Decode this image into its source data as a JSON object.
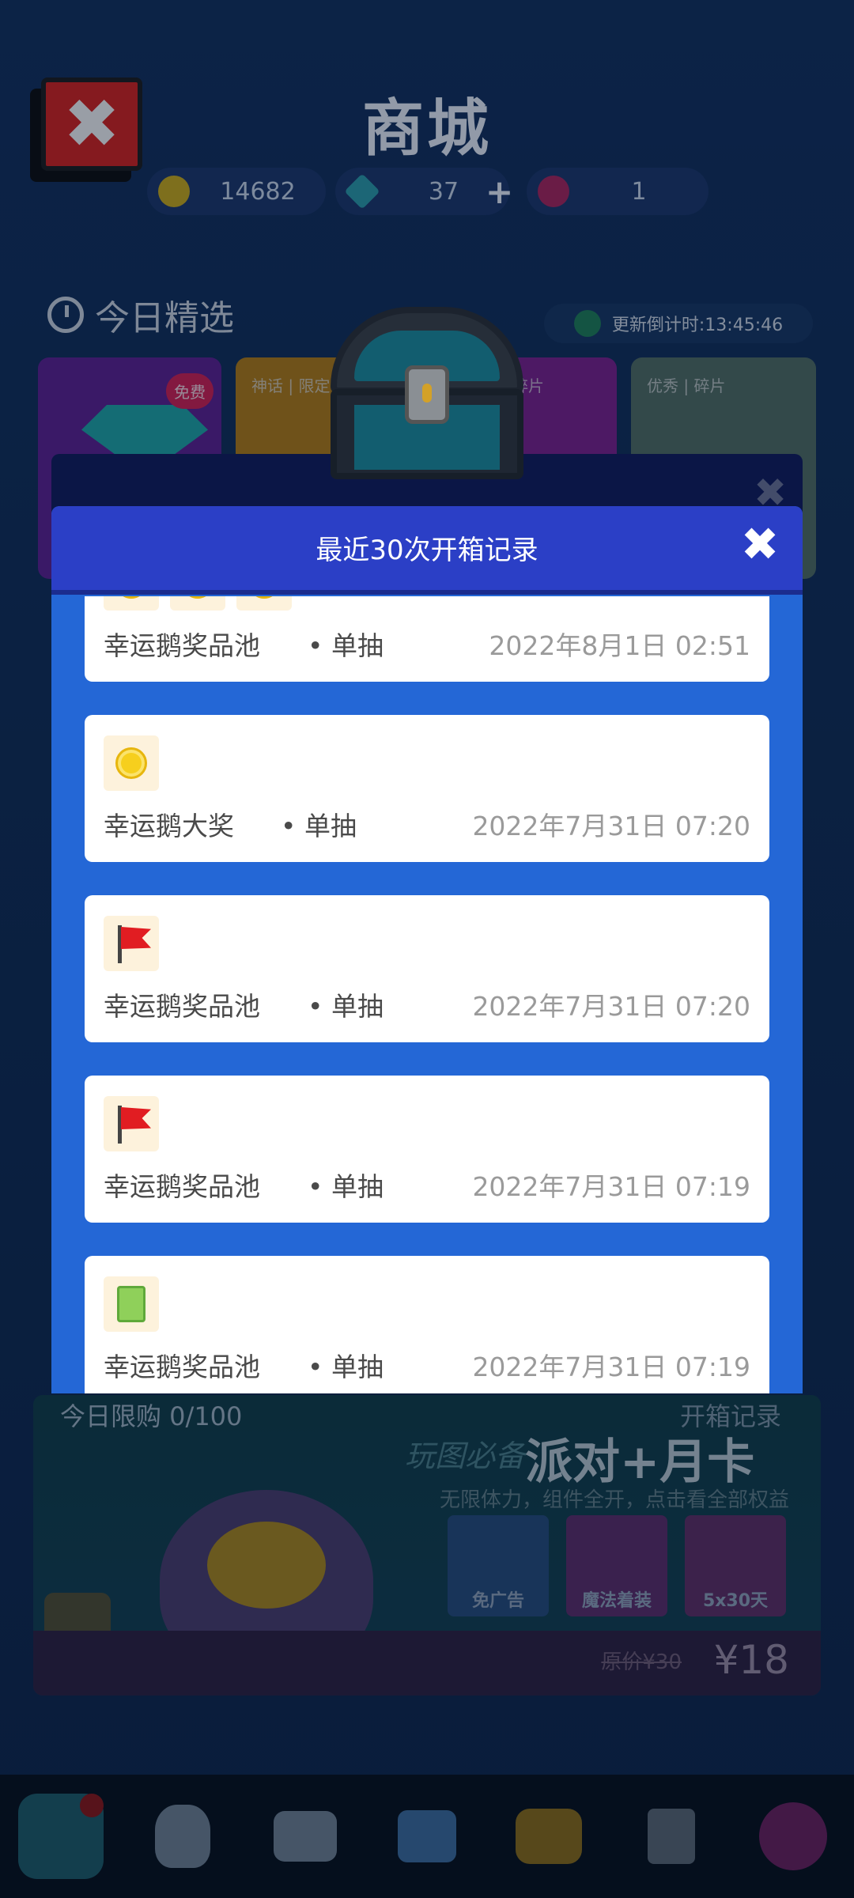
{
  "store": {
    "close_symbol": "✖",
    "title": "商城",
    "coins": "14682",
    "diamonds": "37",
    "plus": "+",
    "tickets": "1",
    "section_title": "今日精选",
    "timer": "更新倒计时:13:45:46",
    "cards": [
      {
        "badge": "免费",
        "label": ""
      },
      {
        "badge": "",
        "label": "神话 | 限定"
      },
      {
        "badge": "",
        "label": "碎片"
      },
      {
        "badge": "",
        "label": "优秀 | 碎片"
      }
    ]
  },
  "promo": {
    "limit": "今日限购 0/100",
    "records_link": "开箱记录",
    "script": "玩图必备",
    "title": "派对+月卡",
    "subtitle": "无限体力，组件全开，点击看全部权益",
    "tiles": [
      "免广告",
      "魔法着装",
      "5x30天"
    ],
    "old_price": "原价¥30",
    "price": "¥18"
  },
  "modal": {
    "title": "最近30次开箱记录",
    "close_symbol": "✖",
    "records": [
      {
        "name": "幸运鹅奖品池",
        "type": "• 单抽",
        "time": "2022年8月1日 02:51",
        "icons": [
          "coin",
          "coin",
          "coin"
        ]
      },
      {
        "name": "幸运鹅大奖",
        "type": "• 单抽",
        "time": "2022年7月31日 07:20",
        "icons": [
          "coin"
        ]
      },
      {
        "name": "幸运鹅奖品池",
        "type": "• 单抽",
        "time": "2022年7月31日 07:20",
        "icons": [
          "flag"
        ]
      },
      {
        "name": "幸运鹅奖品池",
        "type": "• 单抽",
        "time": "2022年7月31日 07:19",
        "icons": [
          "flag"
        ]
      },
      {
        "name": "幸运鹅奖品池",
        "type": "• 单抽",
        "time": "2022年7月31日 07:19",
        "icons": [
          "card"
        ]
      }
    ]
  },
  "nav": {
    "items": [
      "camera-icon",
      "bunny-icon",
      "chat-star-icon",
      "tv-robot-icon",
      "mask-icon",
      "joystick-icon",
      "lotus-icon"
    ]
  },
  "colors": {
    "modal_body": "#2467d6",
    "modal_header": "#2b3fc6",
    "card": "#ffffff",
    "coin": "#f6cf1d",
    "flag": "#e11d22"
  }
}
